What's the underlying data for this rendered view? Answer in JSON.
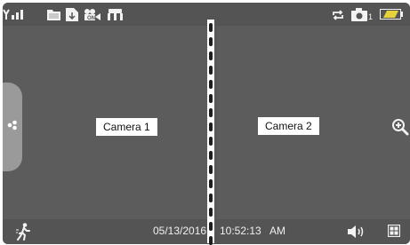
{
  "status_bar": {
    "left_icons": [
      "signal-strength-icon",
      "folder-icon",
      "document-icon",
      "video-camera-icon",
      "network-icon"
    ],
    "right_icons": [
      "repeat-icon",
      "camera-snapshot-icon",
      "battery-icon"
    ],
    "camera_count": "1"
  },
  "cameras": [
    {
      "label": "Camera 1"
    },
    {
      "label": "Camera 2"
    }
  ],
  "side_controls": {
    "left_handle_icon": "menu-dots-icon",
    "right_icon": "zoom-in-icon"
  },
  "bottom_bar": {
    "date": "05/13/2016",
    "time": "10:52:13",
    "ampm": "AM",
    "left_icon": "motion-detection-icon",
    "right_icons": [
      "speaker-icon",
      "grid-layout-icon"
    ]
  },
  "colors": {
    "background": "#585858",
    "bar": "#545454",
    "icon": "#f2f2f2",
    "battery_fill": "#e6d23a"
  }
}
